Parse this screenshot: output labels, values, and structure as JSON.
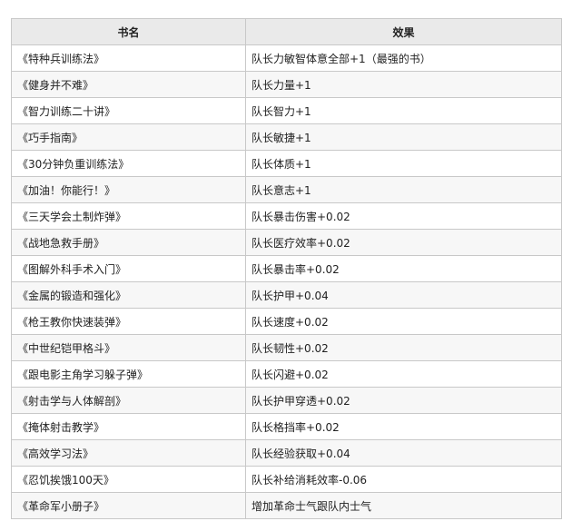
{
  "table": {
    "headers": [
      "书名",
      "效果"
    ],
    "rows": [
      [
        "《特种兵训练法》",
        "队长力敏智体意全部+1（最强的书）"
      ],
      [
        "《健身并不难》",
        "队长力量+1"
      ],
      [
        "《智力训练二十讲》",
        "队长智力+1"
      ],
      [
        "《巧手指南》",
        "队长敏捷+1"
      ],
      [
        "《30分钟负重训练法》",
        "队长体质+1"
      ],
      [
        "《加油！你能行！》",
        "队长意志+1"
      ],
      [
        "《三天学会土制炸弹》",
        "队长暴击伤害+0.02"
      ],
      [
        "《战地急救手册》",
        "队长医疗效率+0.02"
      ],
      [
        "《图解外科手术入门》",
        "队长暴击率+0.02"
      ],
      [
        "《金属的锻造和强化》",
        "队长护甲+0.04"
      ],
      [
        "《枪王教你快速装弹》",
        "队长速度+0.02"
      ],
      [
        "《中世纪铠甲格斗》",
        "队长韧性+0.02"
      ],
      [
        "《跟电影主角学习躲子弹》",
        "队长闪避+0.02"
      ],
      [
        "《射击学与人体解剖》",
        "队长护甲穿透+0.02"
      ],
      [
        "《掩体射击教学》",
        "队长格挡率+0.02"
      ],
      [
        "《高效学习法》",
        "队长经验获取+0.04"
      ],
      [
        "《忍饥挨饿100天》",
        "队长补给消耗效率-0.06"
      ],
      [
        "《革命军小册子》",
        "增加革命士气跟队内士气"
      ]
    ]
  }
}
